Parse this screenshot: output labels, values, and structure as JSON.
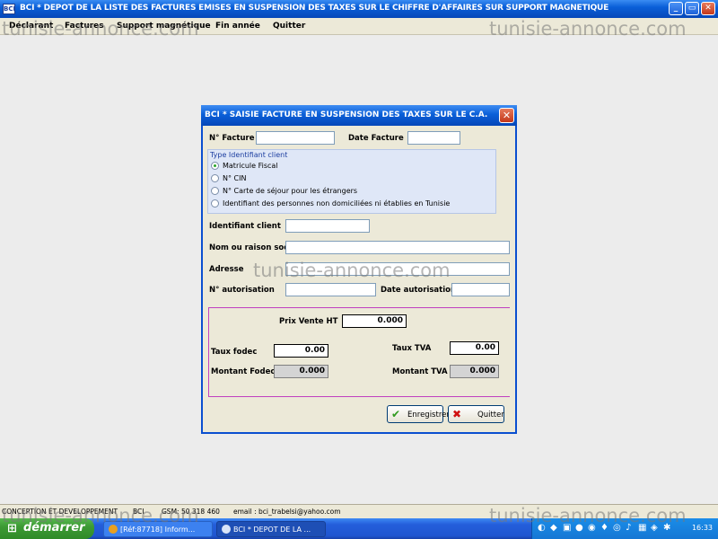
{
  "main_window": {
    "app_icon": "BCI",
    "title": "BCI * DEPOT DE LA LISTE DES FACTURES EMISES EN SUSPENSION DES TAXES SUR LE CHIFFRE D'AFFAIRES SUR SUPPORT MAGNETIQUE",
    "controls": {
      "minimize": "_",
      "maximize": "▭",
      "close": "✕"
    }
  },
  "menubar": {
    "items": [
      "Déclarant",
      "Factures",
      "Support magnétique",
      "Fin année",
      "Quitter"
    ]
  },
  "watermark": {
    "text": "tunisie-annonce.com"
  },
  "dialog": {
    "title": "BCI * SAISIE FACTURE EN SUSPENSION DES TAXES SUR LE C.A.",
    "close_glyph": "✕",
    "fields": {
      "num_facture": {
        "label": "N° Facture",
        "value": ""
      },
      "date_facture": {
        "label": "Date Facture",
        "value": ""
      },
      "identifiant_client": {
        "label": "Identifiant client",
        "value": ""
      },
      "nom_raison": {
        "label": "Nom ou raison soci",
        "value": ""
      },
      "adresse": {
        "label": "Adresse",
        "value": ""
      },
      "num_autorisation": {
        "label": "N° autorisation",
        "value": ""
      },
      "date_autorisation": {
        "label": "Date autorisation",
        "value": ""
      }
    },
    "type_identifiant": {
      "legend": "Type Identifiant client",
      "options": [
        "Matricule Fiscal",
        "N° CIN",
        "N° Carte de séjour pour les étrangers",
        "Identifiant des personnes non domiciliées ni établies en Tunisie"
      ],
      "selected_index": 0
    },
    "pricing": {
      "prix_vente_ht": {
        "label": "Prix Vente HT",
        "value": "0.000"
      },
      "taux_fodec": {
        "label": "Taux fodec",
        "value": "0.00"
      },
      "taux_tva": {
        "label": "Taux TVA",
        "value": "0.00"
      },
      "montant_fodec": {
        "label": "Montant Fodec",
        "value": "0.000"
      },
      "montant_tva": {
        "label": "Montant TVA",
        "value": "0.000"
      }
    },
    "buttons": {
      "enregistrer": "Enregistrer",
      "quitter": "Quitter"
    }
  },
  "statusbar": {
    "segments": [
      "CONCEPTION ET DEVELOPPEMENT",
      "BCI",
      "GSM: 50 318 460",
      "email : bci_trabelsi@yahoo.com"
    ]
  },
  "taskbar": {
    "start_label": "démarrer",
    "tasks": [
      "[Réf:87718] Inform...",
      "BCI * DEPOT DE LA ..."
    ],
    "clock": "16:33",
    "colors": {
      "start": "#3c9a34",
      "taskbar": "#245edb",
      "tray": "#1577d4"
    }
  }
}
